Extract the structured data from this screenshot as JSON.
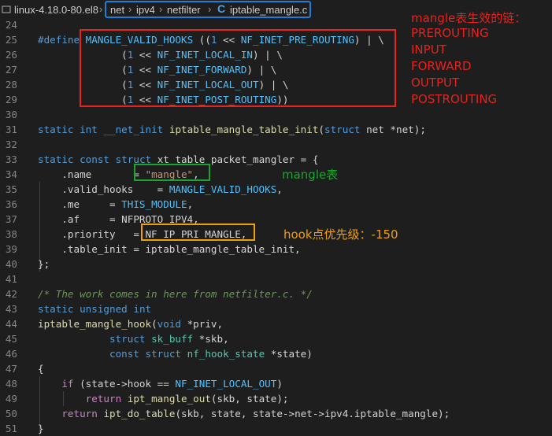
{
  "breadcrumb": {
    "folder": "linux-4.18.0-80.el8",
    "path": [
      "net",
      "ipv4",
      "netfilter"
    ],
    "file": "iptable_mangle.c",
    "separator": "›"
  },
  "code_lines": [
    {
      "num": "24",
      "html": ""
    },
    {
      "num": "25",
      "html": "<span class=\"kw\">#define</span> <span class=\"macro\">MANGLE_VALID_HOOKS</span> ((<span class=\"kw\">1</span> &lt;&lt; <span class=\"macro\">NF_INET_PRE_ROUTING</span>) | \\"
    },
    {
      "num": "26",
      "html": "              (<span class=\"kw\">1</span> &lt;&lt; <span class=\"macro\">NF_INET_LOCAL_IN</span>) | \\"
    },
    {
      "num": "27",
      "html": "              (<span class=\"kw\">1</span> &lt;&lt; <span class=\"macro\">NF_INET_FORWARD</span>) | \\"
    },
    {
      "num": "28",
      "html": "              (<span class=\"kw\">1</span> &lt;&lt; <span class=\"macro\">NF_INET_LOCAL_OUT</span>) | \\"
    },
    {
      "num": "29",
      "html": "              (<span class=\"kw\">1</span> &lt;&lt; <span class=\"macro\">NF_INET_POST_ROUTING</span>))"
    },
    {
      "num": "30",
      "html": ""
    },
    {
      "num": "31",
      "html": "<span class=\"kw\">static</span> <span class=\"kw\">int</span> <span class=\"kw\">__net_init</span> <span class=\"fn\">iptable_mangle_table_init</span>(<span class=\"kw\">struct</span> net *net);"
    },
    {
      "num": "32",
      "html": ""
    },
    {
      "num": "33",
      "html": "<span class=\"kw\">static</span> <span class=\"kw\">const</span> <span class=\"kw\">struct</span> xt_table packet_mangler = {"
    },
    {
      "num": "34",
      "html": "    .name       = <span class=\"str\">\"mangle\"</span>,"
    },
    {
      "num": "35",
      "html": "    .valid_hooks    = <span class=\"macro\">MANGLE_VALID_HOOKS</span>,"
    },
    {
      "num": "36",
      "html": "    .me     = <span class=\"macro\">THIS_MODULE</span>,"
    },
    {
      "num": "37",
      "html": "    .af     = NFPROTO_IPV4,"
    },
    {
      "num": "38",
      "html": "    .priority   = NF_IP_PRI_MANGLE,"
    },
    {
      "num": "39",
      "html": "    .table_init = iptable_mangle_table_init,"
    },
    {
      "num": "40",
      "html": "};"
    },
    {
      "num": "41",
      "html": ""
    },
    {
      "num": "42",
      "html": "<span class=\"cm\">/* The work comes in here from netfilter.c. */</span>"
    },
    {
      "num": "43",
      "html": "<span class=\"kw\">static</span> <span class=\"kw\">unsigned</span> <span class=\"kw\">int</span>"
    },
    {
      "num": "44",
      "html": "<span class=\"fn\">iptable_mangle_hook</span>(<span class=\"kw\">void</span> *priv,"
    },
    {
      "num": "45",
      "html": "            <span class=\"kw\">struct</span> <span class=\"ty\">sk_buff</span> *skb,"
    },
    {
      "num": "46",
      "html": "            <span class=\"kw\">const</span> <span class=\"kw\">struct</span> <span class=\"ty\">nf_hook_state</span> *state)"
    },
    {
      "num": "47",
      "html": "{"
    },
    {
      "num": "48",
      "html": "    <span class=\"ctl\">if</span> (state-&gt;hook == <span class=\"macro\">NF_INET_LOCAL_OUT</span>)"
    },
    {
      "num": "49",
      "html": "        <span class=\"ctl\">return</span> <span class=\"fn\">ipt_mangle_out</span>(skb, state);"
    },
    {
      "num": "50",
      "html": "    <span class=\"ctl\">return</span> <span class=\"fn\">ipt_do_table</span>(skb, state, state-&gt;net-&gt;ipv4.iptable_mangle);"
    },
    {
      "num": "51",
      "html": "}"
    }
  ],
  "annotations": {
    "chains_title": "mangle表生效的链：",
    "chains": [
      "PREROUTING",
      "INPUT",
      "FORWARD",
      "OUTPUT",
      "POSTROUTING"
    ],
    "table_label": "mangle表",
    "priority_label": "hook点优先级：-150"
  },
  "colors": {
    "red": "#e8221d",
    "green": "#19a530",
    "orange": "#f0a000",
    "blue": "#1e7fd6"
  }
}
